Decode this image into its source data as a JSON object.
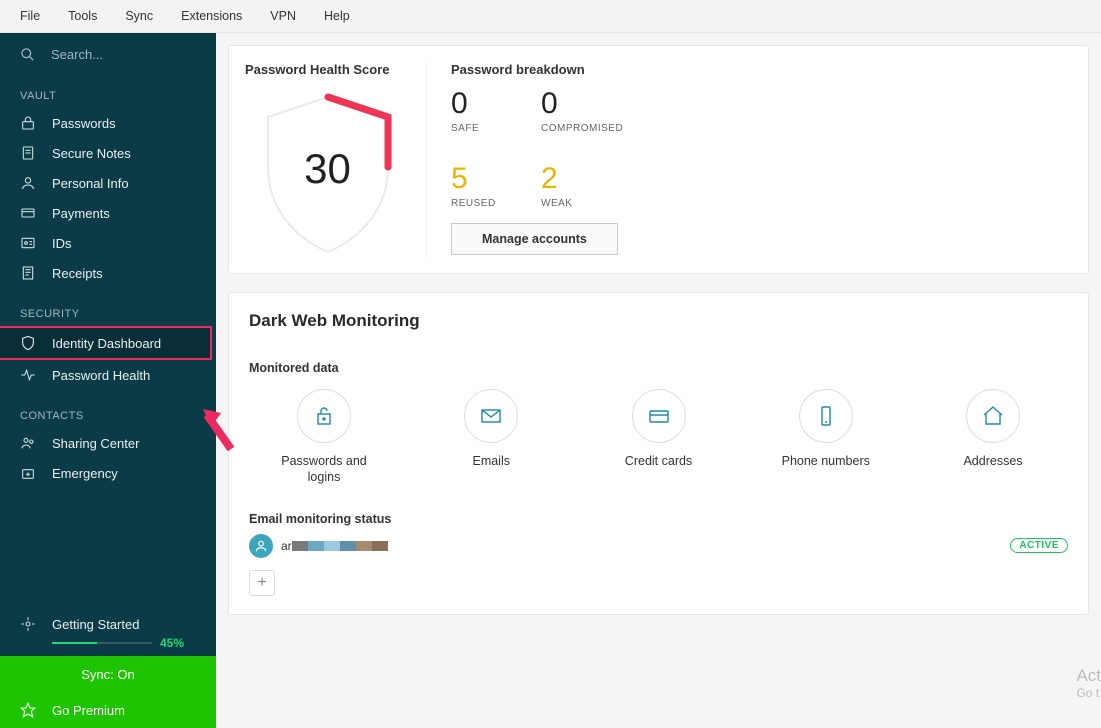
{
  "menubar": [
    "File",
    "Tools",
    "Sync",
    "Extensions",
    "VPN",
    "Help"
  ],
  "search": {
    "placeholder": "Search..."
  },
  "sections": {
    "vault": {
      "label": "VAULT",
      "items": [
        "Passwords",
        "Secure Notes",
        "Personal Info",
        "Payments",
        "IDs",
        "Receipts"
      ]
    },
    "security": {
      "label": "SECURITY",
      "items": [
        "Identity Dashboard",
        "Password Health"
      ],
      "activeIndex": 0
    },
    "contacts": {
      "label": "CONTACTS",
      "items": [
        "Sharing Center",
        "Emergency"
      ]
    }
  },
  "gettingStarted": {
    "label": "Getting Started",
    "percent": "45%",
    "fill": 45
  },
  "sync": {
    "label": "Sync: On"
  },
  "premium": {
    "label": "Go Premium"
  },
  "score": {
    "title": "Password Health Score",
    "value": "30"
  },
  "breakdown": {
    "title": "Password breakdown",
    "safe": {
      "value": "0",
      "label": "SAFE"
    },
    "compromised": {
      "value": "0",
      "label": "COMPROMISED"
    },
    "reused": {
      "value": "5",
      "label": "REUSED"
    },
    "weak": {
      "value": "2",
      "label": "WEAK"
    },
    "manage": "Manage accounts"
  },
  "dwm": {
    "title": "Dark Web Monitoring",
    "monitored_title": "Monitored data",
    "items": [
      "Passwords and logins",
      "Emails",
      "Credit cards",
      "Phone numbers",
      "Addresses"
    ],
    "ems_title": "Email monitoring status",
    "ems_prefix": "ar",
    "active": "ACTIVE"
  },
  "watermark": {
    "l1": "Act",
    "l2": "Go t"
  }
}
